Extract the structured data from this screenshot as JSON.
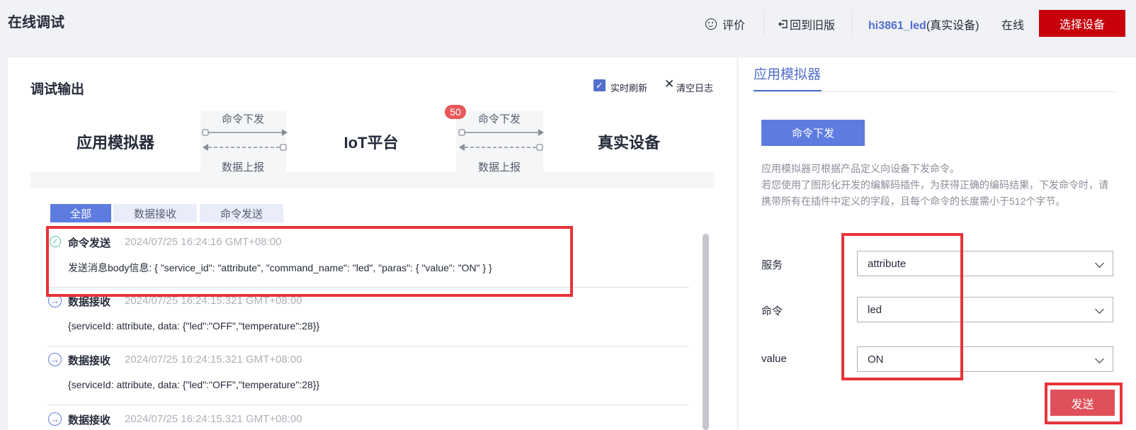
{
  "header": {
    "title": "在线调试",
    "rate_label": "评价",
    "back_label": "回到旧版",
    "device_name": "hi3861_led",
    "device_type": "(真实设备)",
    "status": "在线",
    "select_device": "选择设备"
  },
  "debug": {
    "title": "调试输出",
    "realtime_label": "实时刷新",
    "realtime_checked": true,
    "clear_label": "清空日志"
  },
  "flow": {
    "app_sim": "应用模拟器",
    "platform": "IoT平台",
    "device": "真实设备",
    "cmd_down_1": "命令下发",
    "data_up_1": "数据上报",
    "cmd_down_2": "命令下发",
    "data_up_2": "数据上报",
    "badge": "50"
  },
  "tabs": [
    {
      "label": "全部",
      "active": true
    },
    {
      "label": "数据接收",
      "active": false
    },
    {
      "label": "命令发送",
      "active": false
    }
  ],
  "logs": [
    {
      "type": "send",
      "title": "命令发送",
      "time": "2024/07/25 16:24:16 GMT+08:00",
      "body": "发送消息body信息: { \"service_id\": \"attribute\", \"command_name\": \"led\", \"paras\": { \"value\": \"ON\" } }"
    },
    {
      "type": "recv",
      "title": "数据接收",
      "time": "2024/07/25 16:24:15.321 GMT+08:00",
      "body": "{serviceId: attribute, data: {\"led\":\"OFF\",\"temperature\":28}}"
    },
    {
      "type": "recv",
      "title": "数据接收",
      "time": "2024/07/25 16:24:15.321 GMT+08:00",
      "body": "{serviceId: attribute, data: {\"led\":\"OFF\",\"temperature\":28}}"
    },
    {
      "type": "recv",
      "title": "数据接收",
      "time": "2024/07/25 16:24:15.321 GMT+08:00",
      "body": ""
    }
  ],
  "simulator": {
    "title": "应用模拟器",
    "cmd_button": "命令下发",
    "desc_1": "应用模拟器可根据产品定义向设备下发命令。",
    "desc_2": "若您使用了图形化开发的编解码插件，为获得正确的编码结果，下发命令时，请携带所有在插件中定义的字段，且每个命令的长度需小于512个字节。",
    "service_label": "服务",
    "service_value": "attribute",
    "command_label": "命令",
    "command_value": "led",
    "value_label": "value",
    "value_value": "ON",
    "send_button": "发送"
  },
  "colors": {
    "brand_red": "#c7000b",
    "accent_blue": "#5e7ce0",
    "highlight_red": "#e8333a"
  }
}
